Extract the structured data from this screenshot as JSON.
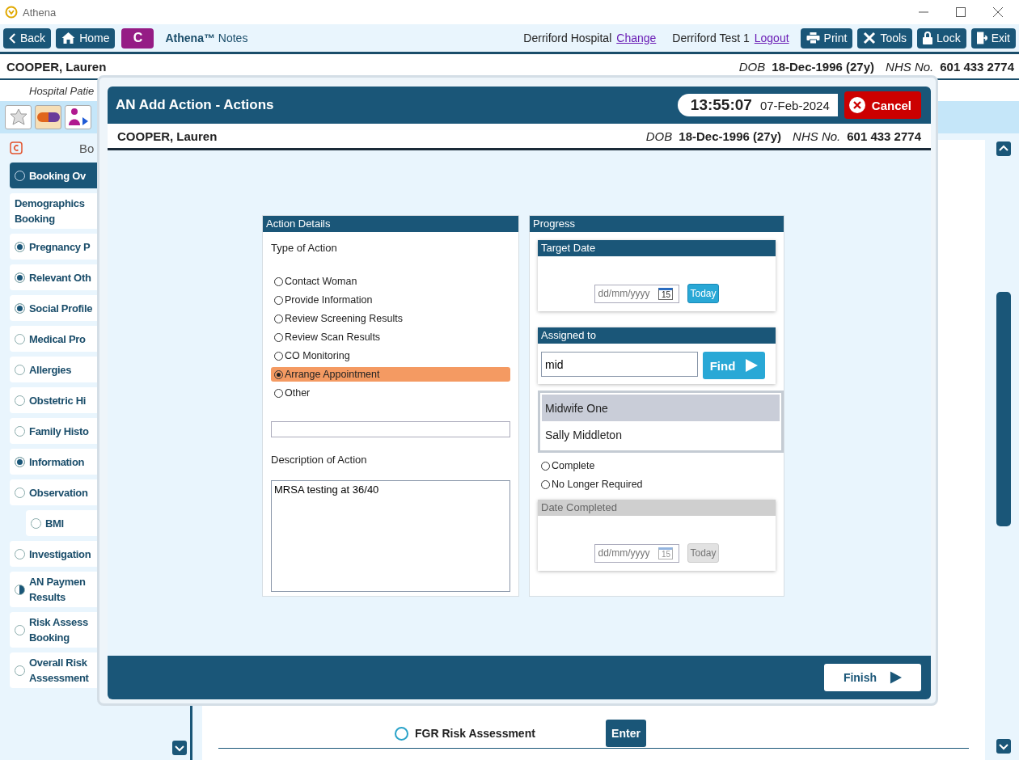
{
  "window": {
    "title": "Athena"
  },
  "toolbar": {
    "nav": [
      {
        "label": "Back",
        "kind": "back"
      },
      {
        "label": "Home",
        "kind": "home"
      }
    ],
    "badge": "C",
    "app_name": "Athena™",
    "app_suffix": "Notes",
    "location": "Derriford Hospital",
    "change_link": "Change",
    "user": "Derriford Test 1",
    "logout_link": "Logout",
    "actions": [
      {
        "label": "Print",
        "kind": "print"
      },
      {
        "label": "Tools",
        "kind": "tools"
      },
      {
        "label": "Lock",
        "kind": "lock"
      },
      {
        "label": "Exit",
        "kind": "exit"
      }
    ]
  },
  "patient": {
    "name": "COOPER, Lauren",
    "dob_label": "DOB",
    "dob": "18-Dec-1996 (27y)",
    "nhs_label": "NHS No.",
    "nhs": "601 433 2774"
  },
  "subheader": "Hospital Patie",
  "tool_icons": [
    {
      "kind": "star",
      "selected": false
    },
    {
      "kind": "pill",
      "selected": true
    },
    {
      "kind": "person",
      "selected": false
    }
  ],
  "sidebar": {
    "heading": "Bo",
    "items": [
      {
        "label": "Booking Ov",
        "kind": "empty",
        "selected": true
      },
      {
        "label": "Demographics\nBooking",
        "kind": "plain",
        "selected": false
      },
      {
        "label": "Pregnancy P",
        "kind": "complete",
        "selected": false
      },
      {
        "label": "Relevant Oth",
        "kind": "complete",
        "selected": false
      },
      {
        "label": "Social Profile",
        "kind": "complete",
        "selected": false
      },
      {
        "label": "Medical Pro",
        "kind": "empty",
        "selected": false
      },
      {
        "label": "Allergies",
        "kind": "empty",
        "selected": false
      },
      {
        "label": "Obstetric Hi",
        "kind": "empty",
        "selected": false
      },
      {
        "label": "Family Histo",
        "kind": "empty",
        "selected": false
      },
      {
        "label": "Information",
        "kind": "complete",
        "selected": false
      },
      {
        "label": "Observation",
        "kind": "empty",
        "selected": false,
        "children": [
          {
            "label": "BMI",
            "kind": "empty",
            "selected": false
          }
        ]
      },
      {
        "label": "Investigation",
        "kind": "empty",
        "selected": false
      },
      {
        "label": "AN Paymen\nResults",
        "kind": "partial",
        "selected": false
      },
      {
        "label": "Risk Assess\nBooking",
        "kind": "empty",
        "selected": false
      },
      {
        "label": "Overall Risk\nAssessment",
        "kind": "empty",
        "selected": false
      }
    ]
  },
  "content": {
    "rows": [
      {
        "label": "FGR Risk Assessment",
        "selected": false,
        "button": "Enter"
      }
    ]
  },
  "modal": {
    "title": "AN Add Action - Actions",
    "time": "13:55:07",
    "date": "07-Feb-2024",
    "cancel": "Cancel",
    "patient": {
      "name": "COOPER, Lauren",
      "dob_label": "DOB",
      "dob": "18-Dec-1996 (27y)",
      "nhs_label": "NHS No.",
      "nhs": "601 433 2774"
    },
    "action_details": {
      "title": "Action Details",
      "type_label": "Type of Action",
      "options": [
        {
          "label": "Contact Woman",
          "selected": false
        },
        {
          "label": "Provide Information",
          "selected": false
        },
        {
          "label": "Review Screening Results",
          "selected": false
        },
        {
          "label": "Review Scan Results",
          "selected": false
        },
        {
          "label": "CO Monitoring",
          "selected": false
        },
        {
          "label": "Arrange Appointment",
          "selected": true
        },
        {
          "label": "Other",
          "selected": false
        }
      ],
      "description_label": "Description of Action",
      "description": "MRSA testing at 36/40"
    },
    "progress": {
      "title": "Progress",
      "target_date": {
        "title": "Target Date",
        "placeholder": "dd/mm/yyyy",
        "calendar_day": "15",
        "today": "Today",
        "disabled": false
      },
      "assigned": {
        "title": "Assigned to",
        "value": "mid",
        "find": "Find",
        "suggestions": [
          {
            "label": "Midwife One",
            "selected": true
          },
          {
            "label": "Sally Middleton",
            "selected": false
          }
        ]
      },
      "status_options": [
        {
          "label": "Complete",
          "selected": false
        },
        {
          "label": "No Longer Required",
          "selected": false
        }
      ],
      "date_completed": {
        "title": "Date Completed",
        "placeholder": "dd/mm/yyyy",
        "calendar_day": "15",
        "today": "Today",
        "disabled": true
      }
    },
    "finish": "Finish"
  }
}
